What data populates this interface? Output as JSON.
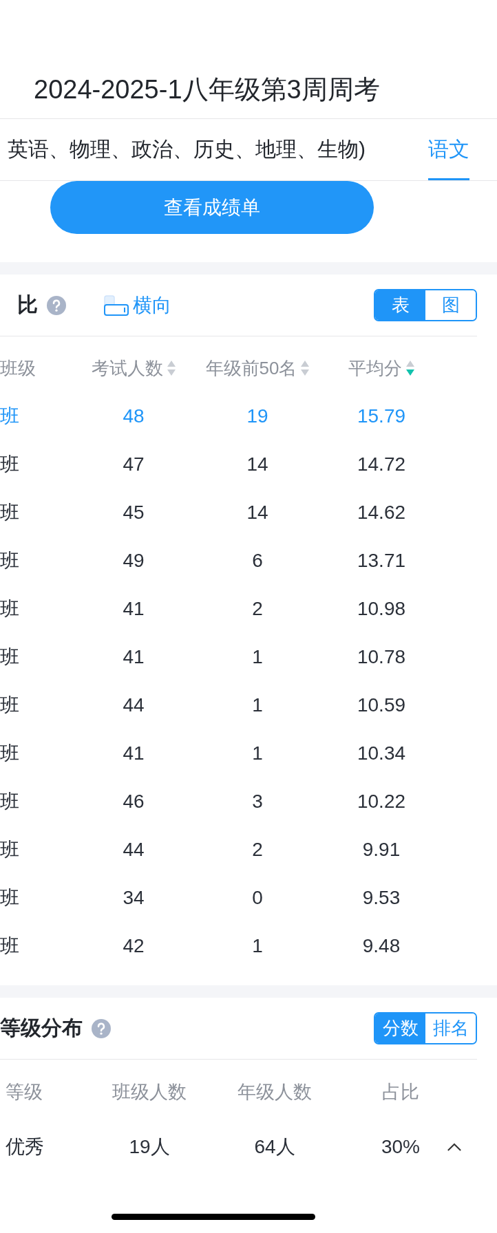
{
  "header": {
    "title": "2024-2025-1八年级第3周周考"
  },
  "subject_tabs": [
    {
      "label": "英语、物理、政治、历史、地理、生物)",
      "selected": false
    },
    {
      "label": "语文",
      "selected": true
    }
  ],
  "report_button": {
    "label": "查看成绩单"
  },
  "class_comparison": {
    "title": "比",
    "orientation_toggle": {
      "label": "横向"
    },
    "view_switch": [
      {
        "label": "表",
        "selected": true
      },
      {
        "label": "图",
        "selected": false
      }
    ],
    "table": {
      "columns": [
        {
          "label": "班级",
          "sortable": false
        },
        {
          "label": "考试人数",
          "sortable": true,
          "sorted_descending": false
        },
        {
          "label": "年级前50名",
          "sortable": true,
          "sorted_descending": false
        },
        {
          "label": "平均分",
          "sortable": true,
          "sorted_descending": true
        }
      ],
      "rows": [
        {
          "cells": [
            "班",
            "48",
            "19",
            "15.79"
          ],
          "selected": true
        },
        {
          "cells": [
            "班",
            "47",
            "14",
            "14.72"
          ],
          "selected": false
        },
        {
          "cells": [
            "班",
            "45",
            "14",
            "14.62"
          ],
          "selected": false
        },
        {
          "cells": [
            "班",
            "49",
            "6",
            "13.71"
          ],
          "selected": false
        },
        {
          "cells": [
            "班",
            "41",
            "2",
            "10.98"
          ],
          "selected": false
        },
        {
          "cells": [
            "班",
            "41",
            "1",
            "10.78"
          ],
          "selected": false
        },
        {
          "cells": [
            "班",
            "44",
            "1",
            "10.59"
          ],
          "selected": false
        },
        {
          "cells": [
            "班",
            "41",
            "1",
            "10.34"
          ],
          "selected": false
        },
        {
          "cells": [
            "班",
            "46",
            "3",
            "10.22"
          ],
          "selected": false
        },
        {
          "cells": [
            "班",
            "44",
            "2",
            "9.91"
          ],
          "selected": false
        },
        {
          "cells": [
            "班",
            "34",
            "0",
            "9.53"
          ],
          "selected": false
        },
        {
          "cells": [
            "班",
            "42",
            "1",
            "9.48"
          ],
          "selected": false
        }
      ]
    }
  },
  "grade_distribution": {
    "title": "等级分布",
    "view_switch": [
      {
        "label": "分数",
        "selected": true
      },
      {
        "label": "排名",
        "selected": false
      }
    ],
    "table": {
      "columns": [
        "等级",
        "班级人数",
        "年级人数",
        "占比"
      ],
      "rows": [
        {
          "cells": [
            "优秀",
            "19人",
            "64人",
            "30%"
          ],
          "expanded": true
        }
      ]
    }
  }
}
